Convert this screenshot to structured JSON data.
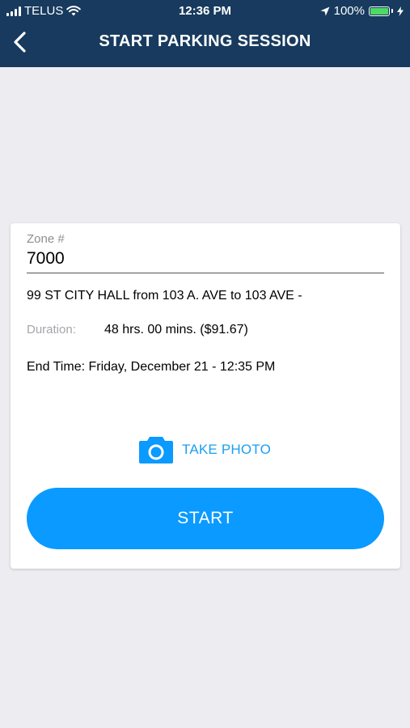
{
  "status_bar": {
    "carrier": "TELUS",
    "time": "12:36 PM",
    "battery": "100%",
    "battery_level": 1.0,
    "battery_color": "#4cd964"
  },
  "nav": {
    "title": "START PARKING SESSION",
    "back_icon": "chevron-left-icon"
  },
  "form": {
    "zone_label": "Zone #",
    "zone_value": "7000",
    "address": "99 ST CITY HALL from 103 A.  AVE to 103 AVE -",
    "duration_label": "Duration:",
    "duration_value": "48 hrs. 00 mins. ($91.67)",
    "end_time": "End Time: Friday, December 21 - 12:35 PM"
  },
  "actions": {
    "photo_label": "TAKE PHOTO",
    "photo_icon": "camera-icon",
    "start_label": "START"
  },
  "colors": {
    "header_bg": "#173a5e",
    "accent": "#0b9aff",
    "page_bg": "#ececf1"
  }
}
